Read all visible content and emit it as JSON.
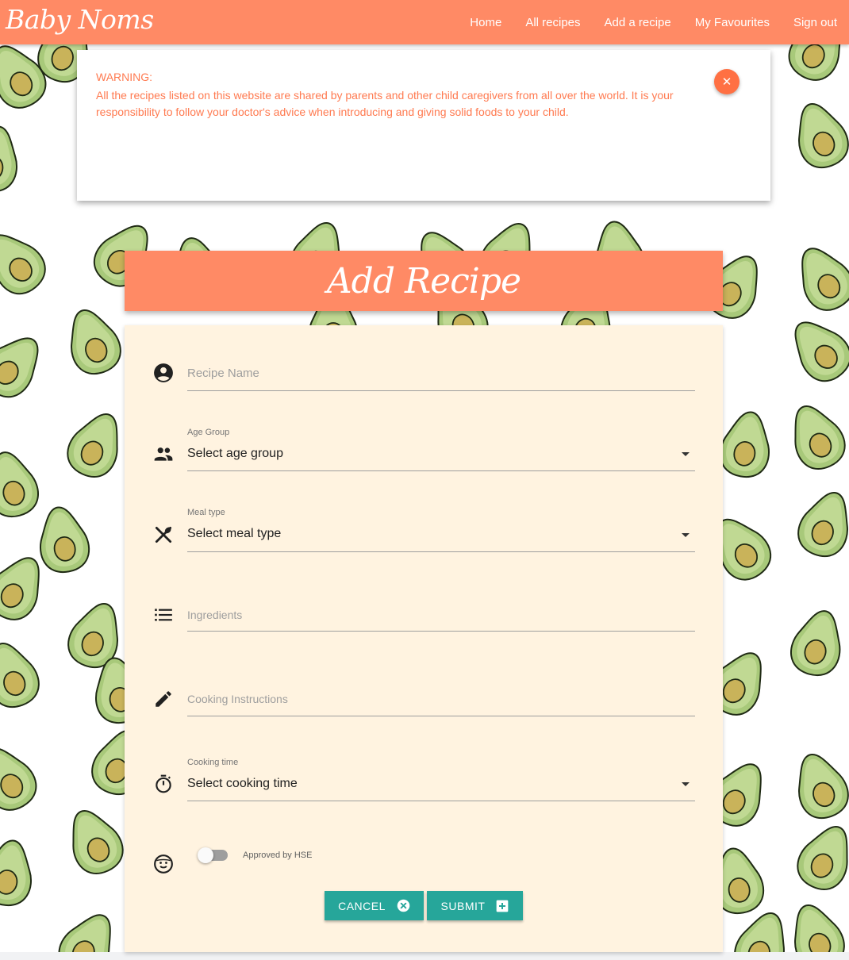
{
  "nav": {
    "brand": "Baby Noms",
    "links": [
      "Home",
      "All recipes",
      "Add a recipe",
      "My Favourites",
      "Sign out"
    ]
  },
  "warning": {
    "title": "WARNING:",
    "text": "All the recipes listed on this website are shared by parents and other child caregivers from all over the world. It is your responsibility to follow your doctor's advice when introducing and giving solid foods to your child.",
    "close_icon": "close-icon"
  },
  "page": {
    "title": "Add Recipe"
  },
  "form": {
    "recipe_name": {
      "placeholder": "Recipe Name",
      "icon": "account-circle-icon"
    },
    "age_group": {
      "label": "Age Group",
      "value": "Select age group",
      "icon": "people-icon"
    },
    "meal_type": {
      "label": "Meal type",
      "value": "Select meal type",
      "icon": "utensils-icon"
    },
    "ingredients": {
      "placeholder": "Ingredients",
      "icon": "list-icon"
    },
    "instructions": {
      "placeholder": "Cooking Instructions",
      "icon": "pencil-icon"
    },
    "cooking_time": {
      "label": "Cooking time",
      "value": "Select cooking time",
      "icon": "timer-icon"
    },
    "approved": {
      "label": "Approved by HSE",
      "checked": false,
      "icon": "baby-face-icon"
    },
    "cancel_label": "CANCEL",
    "submit_label": "SUBMIT"
  },
  "colors": {
    "primary": "#ff8a65",
    "warning_text": "#ff7a50",
    "card_bg": "#fff3e0",
    "button": "#26a69a",
    "avocado_skin": "#a8c97a",
    "avocado_pit": "#c9b35a"
  }
}
